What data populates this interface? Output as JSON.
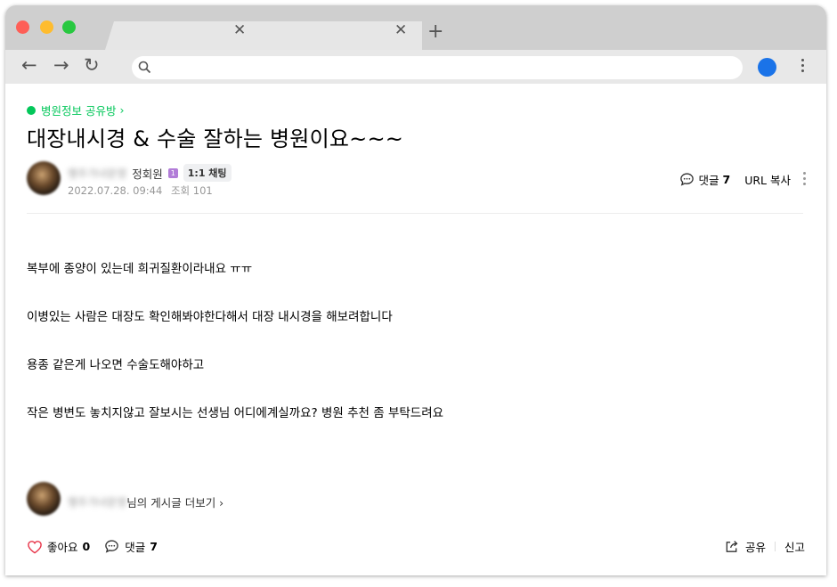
{
  "browser": {
    "tab_close_glyph": "✕",
    "new_tab_glyph": "+",
    "back_glyph": "←",
    "forward_glyph": "→",
    "reload_glyph": "↻",
    "address_value": "",
    "profile_color": "#1a73e8"
  },
  "post": {
    "board_name": "병원정보 공유방",
    "board_chevron": "›",
    "title": "대장내시경 & 수술 잘하는 병원이요~~~",
    "author_nick": "행주가녀운영",
    "author_name": "정회원",
    "level_badge": "1",
    "chat_label": "1:1 채팅",
    "date": "2022.07.28. 09:44",
    "views_label": "조회 101",
    "comment_label": "댓글",
    "comment_count": "7",
    "url_copy_label": "URL 복사",
    "body_lines": [
      "복부에 종양이 있는데 희귀질환이라내요 ㅠㅠ",
      "이병있는 사람은 대장도 확인해봐야한다해서 대장 내시경을 해보려합니다",
      "용종 같은게 나오면 수술도해야하고",
      "작은 병변도 놓치지않고 잘보시는 선생님 어디에계실까요? 병원 추천 좀 부탁드려요"
    ],
    "more_posts_nick": "행주가녀운영",
    "more_posts_label": "님의 게시글 더보기 ›",
    "like_label": "좋아요",
    "like_count": "0",
    "share_label": "공유",
    "report_label": "신고"
  },
  "colors": {
    "accent_green": "#03c75a",
    "heart_red": "#e8364a"
  }
}
